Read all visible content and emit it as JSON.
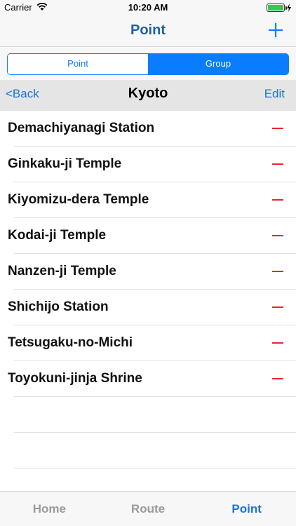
{
  "status_bar": {
    "carrier": "Carrier",
    "time": "10:20 AM"
  },
  "nav": {
    "title": "Point",
    "add_icon": "plus-icon"
  },
  "segment": {
    "options": [
      "Point",
      "Group"
    ],
    "selected": "Group"
  },
  "sub_nav": {
    "back_label": "<Back",
    "title": "Kyoto",
    "edit_label": "Edit"
  },
  "list": {
    "items": [
      "Demachiyanagi Station",
      "Ginkaku-ji Temple",
      "Kiyomizu-dera Temple",
      "Kodai-ji Temple",
      "Nanzen-ji Temple",
      "Shichijo Station",
      "Tetsugaku-no-Michi",
      "Toyokuni-jinja Shrine"
    ],
    "delete_icon": "minus-icon"
  },
  "tab_bar": {
    "tabs": [
      "Home",
      "Route",
      "Point"
    ],
    "active": "Point"
  },
  "colors": {
    "accent": "#0a7cff",
    "title_blue": "#1f5fa6",
    "delete_red": "#e8262b",
    "battery_green": "#34c759"
  }
}
